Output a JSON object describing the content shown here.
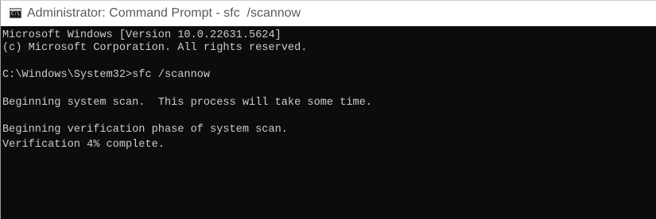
{
  "window": {
    "title": "Administrator: Command Prompt - sfc  /scannow",
    "icon": "command-prompt-icon",
    "icon_glyph": "C:\\"
  },
  "console": {
    "background": "#0c0c0c",
    "foreground": "#cccccc",
    "lines": [
      "Microsoft Windows [Version 10.0.22631.5624]",
      "(c) Microsoft Corporation. All rights reserved.",
      "C:\\Windows\\System32>sfc /scannow",
      "Beginning system scan.  This process will take some time.",
      "Beginning verification phase of system scan.",
      "Verification 4% complete."
    ]
  }
}
